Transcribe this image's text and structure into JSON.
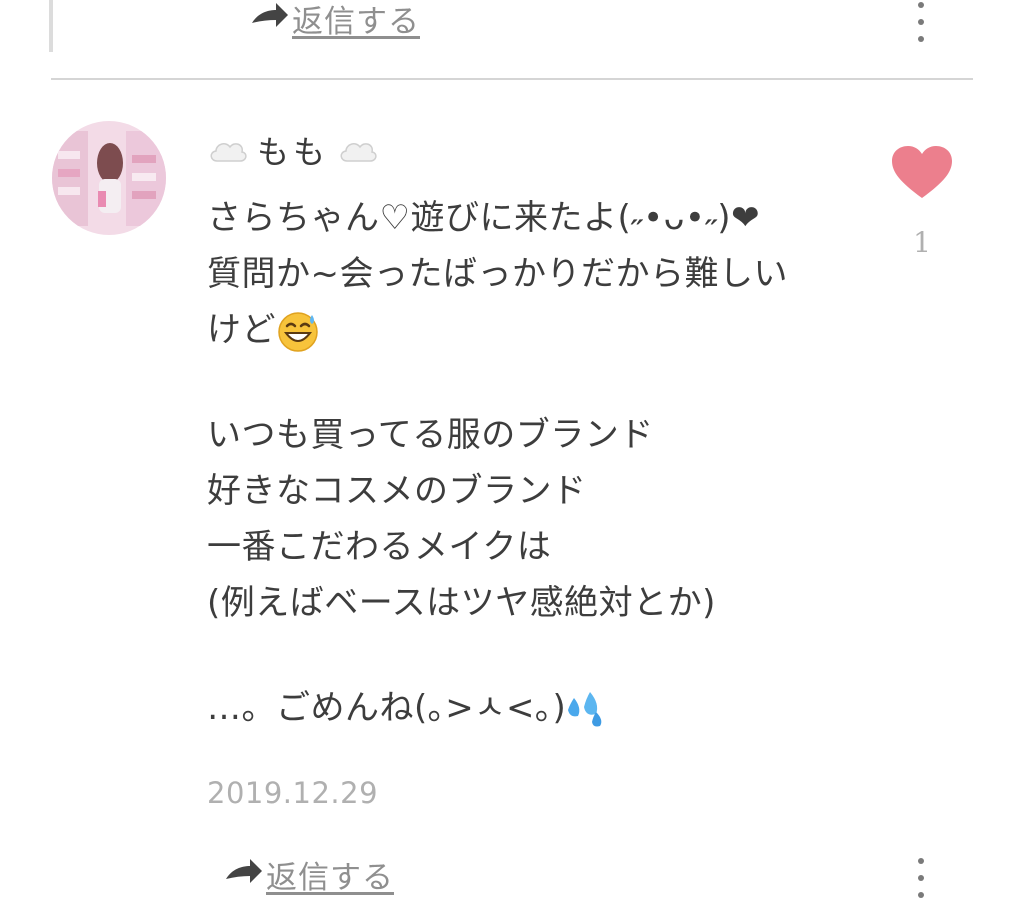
{
  "reply_label": "返信する",
  "comment": {
    "username": "もも",
    "lines": [
      "さらちゃん♡遊びに来たよ(˶•ᴗ•˶)❤",
      "質問か~会ったばっかりだから難しい",
      "けど",
      "",
      "いつも買ってる服のブランド",
      "好きなコスメのブランド",
      "一番こだわるメイクは",
      "(例えばベースはツヤ感絶対とか)",
      "",
      "…。ごめんね(｡>ㅅ<｡)"
    ],
    "date": "2019.12.29",
    "like_count": "1"
  },
  "colors": {
    "heart": "#ec7f8d",
    "divider": "#d5d5d5",
    "meta_text": "#b0b0b0"
  },
  "icons": {
    "reply": "reply-arrow-icon",
    "menu": "kebab-menu-icon",
    "like": "heart-icon",
    "username_decoration": "cloud-icon"
  }
}
